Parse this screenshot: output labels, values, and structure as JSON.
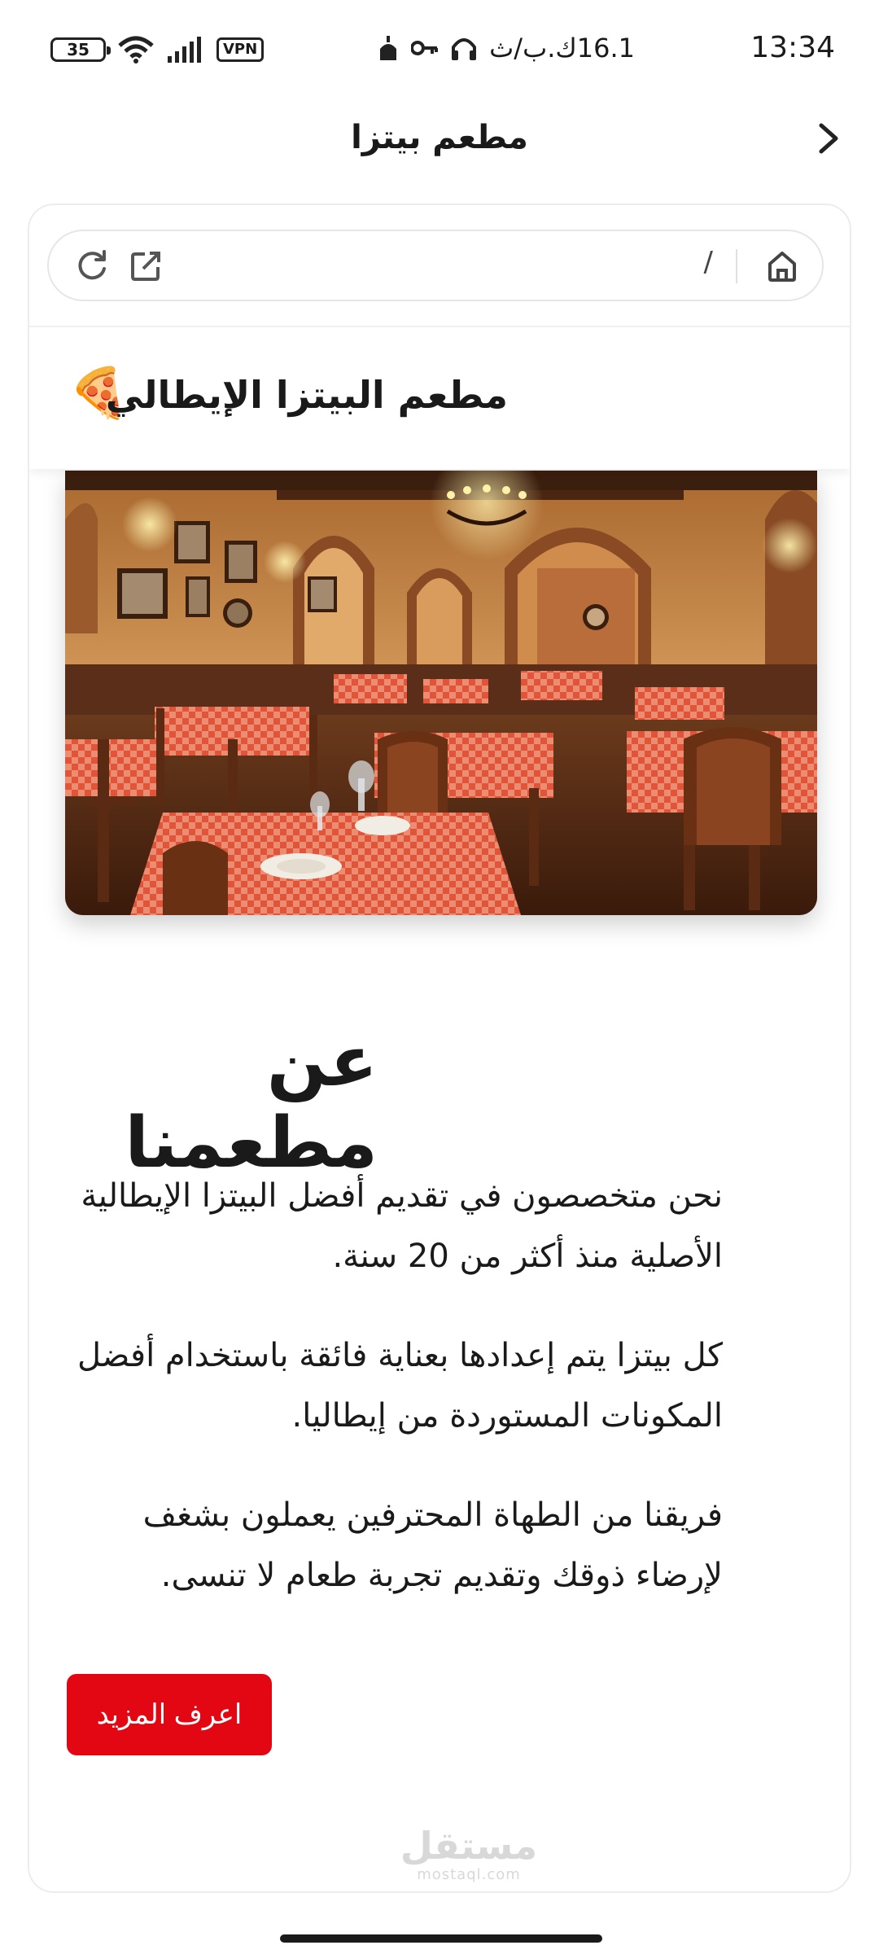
{
  "status_bar": {
    "time": "13:34",
    "data_speed": "16.1ك.ب/ث",
    "battery": "35",
    "vpn": "VPN"
  },
  "app_bar": {
    "title": "مطعم بيتزا",
    "back_icon": "chevron-right-icon"
  },
  "browser": {
    "path": "/",
    "home_icon": "home-icon",
    "reload_icon": "reload-icon",
    "open_external_icon": "open-external-icon"
  },
  "site": {
    "title": "مطعم البيتزا الإيطالي",
    "logo_emoji": "🍕"
  },
  "hero": {
    "image_subject": "restaurant-interior",
    "colors": {
      "wall": "#c98a4b",
      "tablecloth": "#e7533c",
      "wood": "#5a2e18"
    }
  },
  "about": {
    "heading": "عن مطعمنا",
    "paragraphs": [
      "نحن متخصصون في تقديم أفضل البيتزا الإيطالية الأصلية منذ أكثر من 20 سنة.",
      "كل بيتزا يتم إعدادها بعناية فائقة باستخدام أفضل المكونات المستوردة من إيطاليا.",
      "فريقنا من الطهاة المحترفين يعملون بشغف لإرضاء ذوقك وتقديم تجربة طعام لا تنسى."
    ],
    "cta_label": "اعرف المزيد",
    "cta_color": "#e30613"
  },
  "watermark": {
    "main": "مستقل",
    "sub": "mostaql.com"
  }
}
